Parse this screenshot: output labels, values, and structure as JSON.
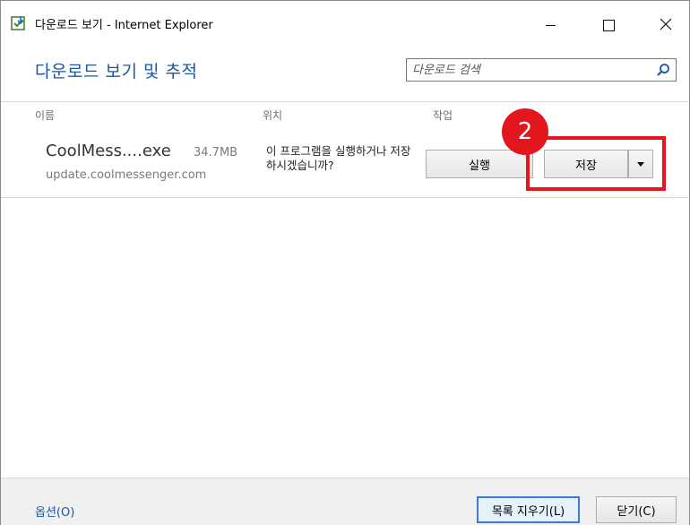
{
  "window": {
    "title": "다운로드 보기 - Internet Explorer",
    "icon": "ie-download-icon"
  },
  "header": {
    "title": "다운로드 보기 및 추적",
    "search_placeholder": "다운로드 검색"
  },
  "columns": {
    "name": "이름",
    "location": "위치",
    "action": "작업"
  },
  "download": {
    "file_name": "CoolMess....exe",
    "size": "34.7MB",
    "url": "update.coolmessenger.com",
    "prompt": "이 프로그램을 실행하거나 저장하시겠습니까?",
    "run_label": "실행",
    "save_label": "저장"
  },
  "annotation": {
    "step_number": "2",
    "color": "#e3161e"
  },
  "footer": {
    "options_label": "옵션(O)",
    "clear_label": "목록 지우기(L)",
    "close_label": "닫기(C)"
  },
  "colors": {
    "heading": "#1a57a3",
    "link": "#1a57a3"
  }
}
